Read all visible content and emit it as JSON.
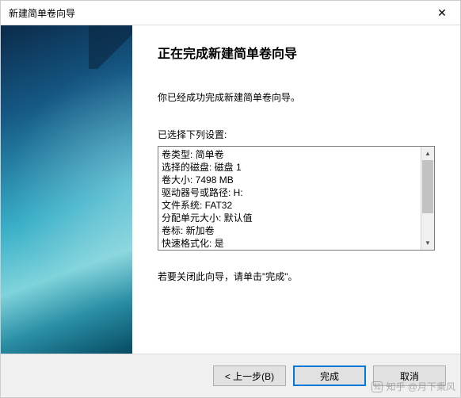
{
  "window": {
    "title": "新建简单卷向导"
  },
  "main": {
    "heading": "正在完成新建简单卷向导",
    "description": "你已经成功完成新建简单卷向导。",
    "settings_label": "已选择下列设置:",
    "settings": [
      "卷类型: 简单卷",
      "选择的磁盘: 磁盘 1",
      "卷大小: 7498 MB",
      "驱动器号或路径: H:",
      "文件系统: FAT32",
      "分配单元大小: 默认值",
      "卷标: 新加卷",
      "快速格式化: 是"
    ],
    "close_hint": "若要关闭此向导，请单击\"完成\"。"
  },
  "buttons": {
    "back": "< 上一步(B)",
    "finish": "完成",
    "cancel": "取消"
  },
  "watermark": {
    "logo": "知",
    "text": "知乎 @月下乘风"
  }
}
